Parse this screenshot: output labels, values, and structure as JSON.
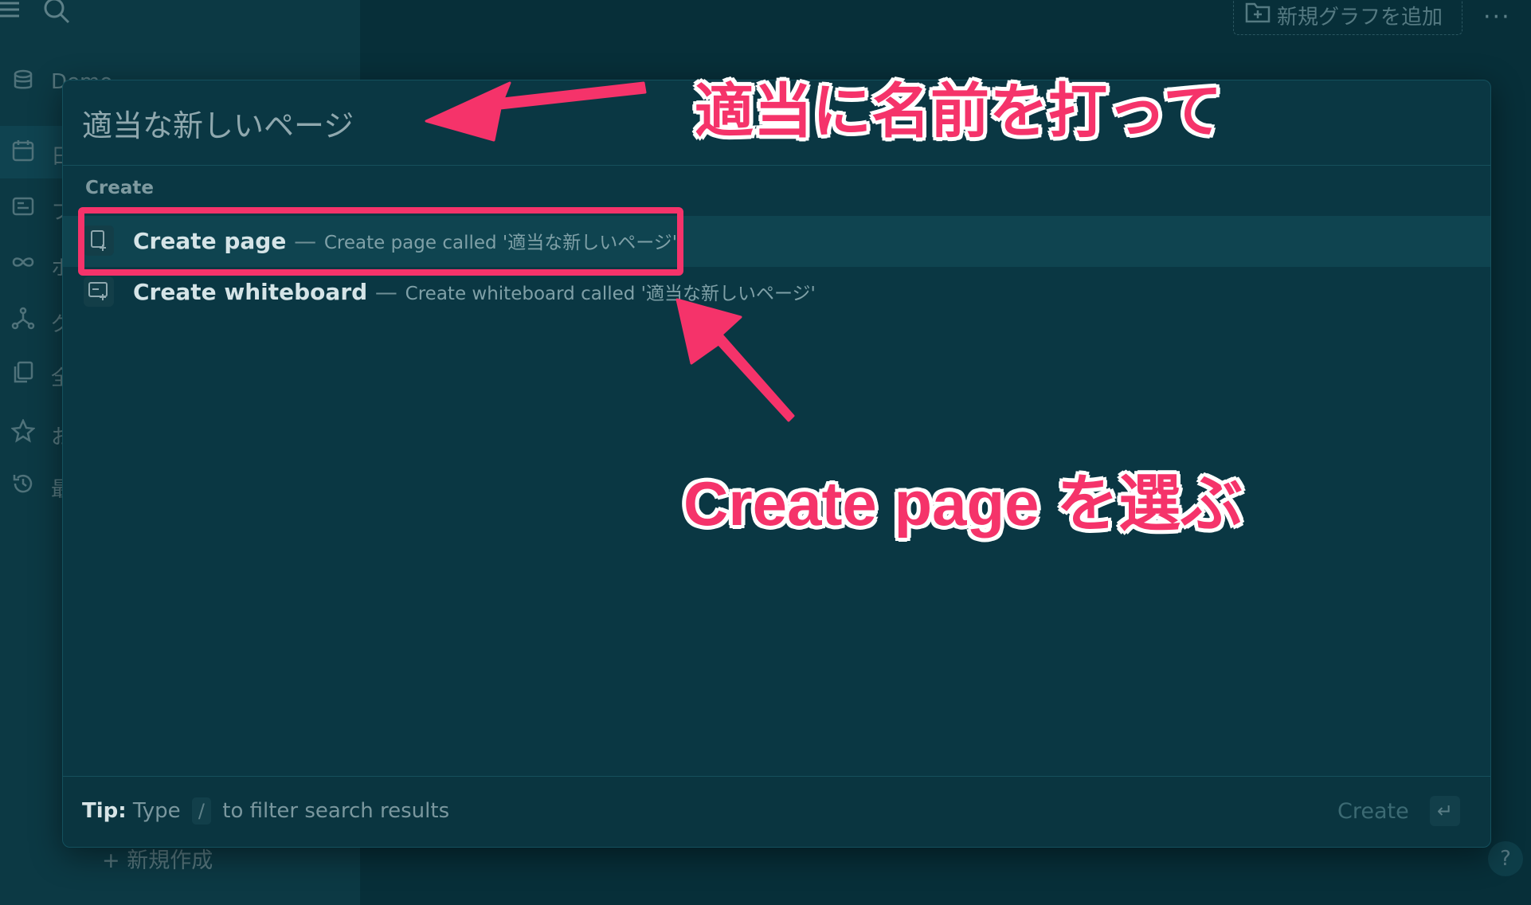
{
  "sidebar": {
    "graph_name": "Demo",
    "items": [
      {
        "icon": "calendar-icon",
        "label": "日"
      },
      {
        "icon": "flashcards-icon",
        "label": "フ"
      },
      {
        "icon": "infinity-icon",
        "label": "ホ"
      },
      {
        "icon": "graph-icon",
        "label": "グ"
      },
      {
        "icon": "pages-icon",
        "label": "全"
      },
      {
        "icon": "star-icon",
        "label": "お"
      },
      {
        "icon": "history-icon",
        "label": "最"
      }
    ],
    "new_item_label": "新規作成"
  },
  "topbar": {
    "add_graph_label": "新規グラフを追加",
    "more_glyph": "···"
  },
  "modal": {
    "search_value": "適当な新しいページ",
    "group_header": "Create",
    "results": [
      {
        "title": "Create page",
        "separator": "—",
        "subtitle": "Create page called '適当な新しいページ'",
        "icon": "new-page-icon",
        "active": true
      },
      {
        "title": "Create whiteboard",
        "separator": "—",
        "subtitle": "Create whiteboard called '適当な新しいページ'",
        "icon": "new-whiteboard-icon",
        "active": false
      }
    ],
    "footer": {
      "tip_label": "Tip:",
      "tip_pre": "Type",
      "tip_key": "/",
      "tip_post": "to filter search results",
      "action_label": "Create",
      "enter_glyph": "↵"
    }
  },
  "annotations": {
    "callout_1": "適当に名前を打って",
    "callout_2": "Create page を選ぶ",
    "color": "#f5336a"
  },
  "help_glyph": "?"
}
